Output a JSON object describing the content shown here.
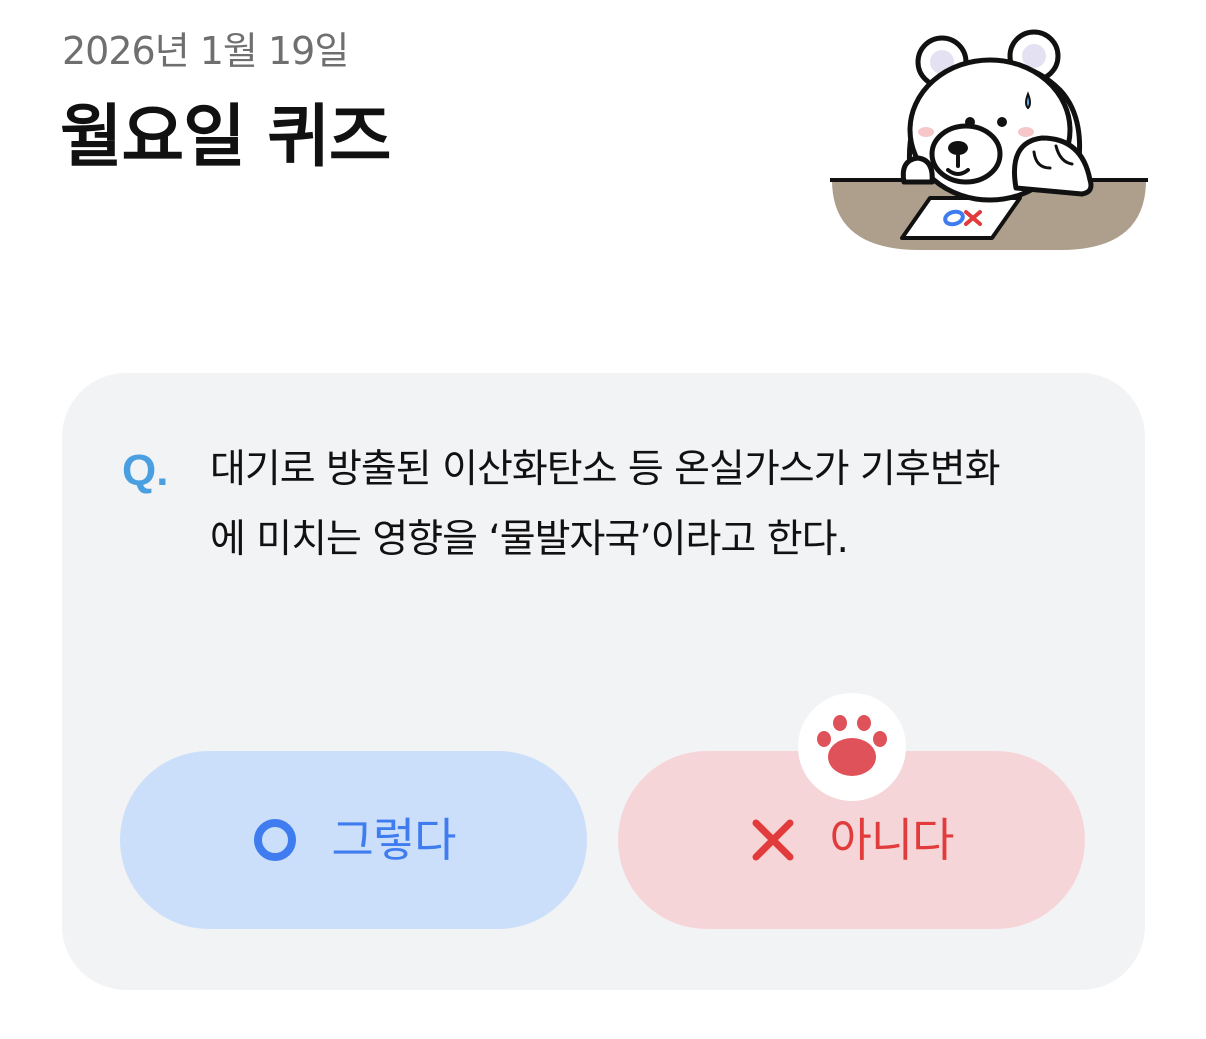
{
  "header": {
    "date": "2026년 1월 19일",
    "title": "월요일 퀴즈"
  },
  "illustration": {
    "icon": "bear-mascot-icon",
    "paper_marks": "OX"
  },
  "quiz": {
    "q_marker": "Q.",
    "question": "대기로 방출된 이산화탄소 등 온실가스가 기후변화에 미치는 영향을 ‘물발자국’이라고 한다.",
    "answers": [
      {
        "label": "그렇다",
        "icon": "circle-o-icon",
        "color": "#3f7cf0",
        "background": "#cbdffb"
      },
      {
        "label": "아니다",
        "icon": "x-mark-icon",
        "color": "#e23b3b",
        "background": "#f6d5d8"
      }
    ],
    "selection_icon": "paw-icon"
  },
  "colors": {
    "card_background": "#f2f3f5",
    "q_marker": "#4a9fe0",
    "date_text": "#6f6f6f"
  }
}
